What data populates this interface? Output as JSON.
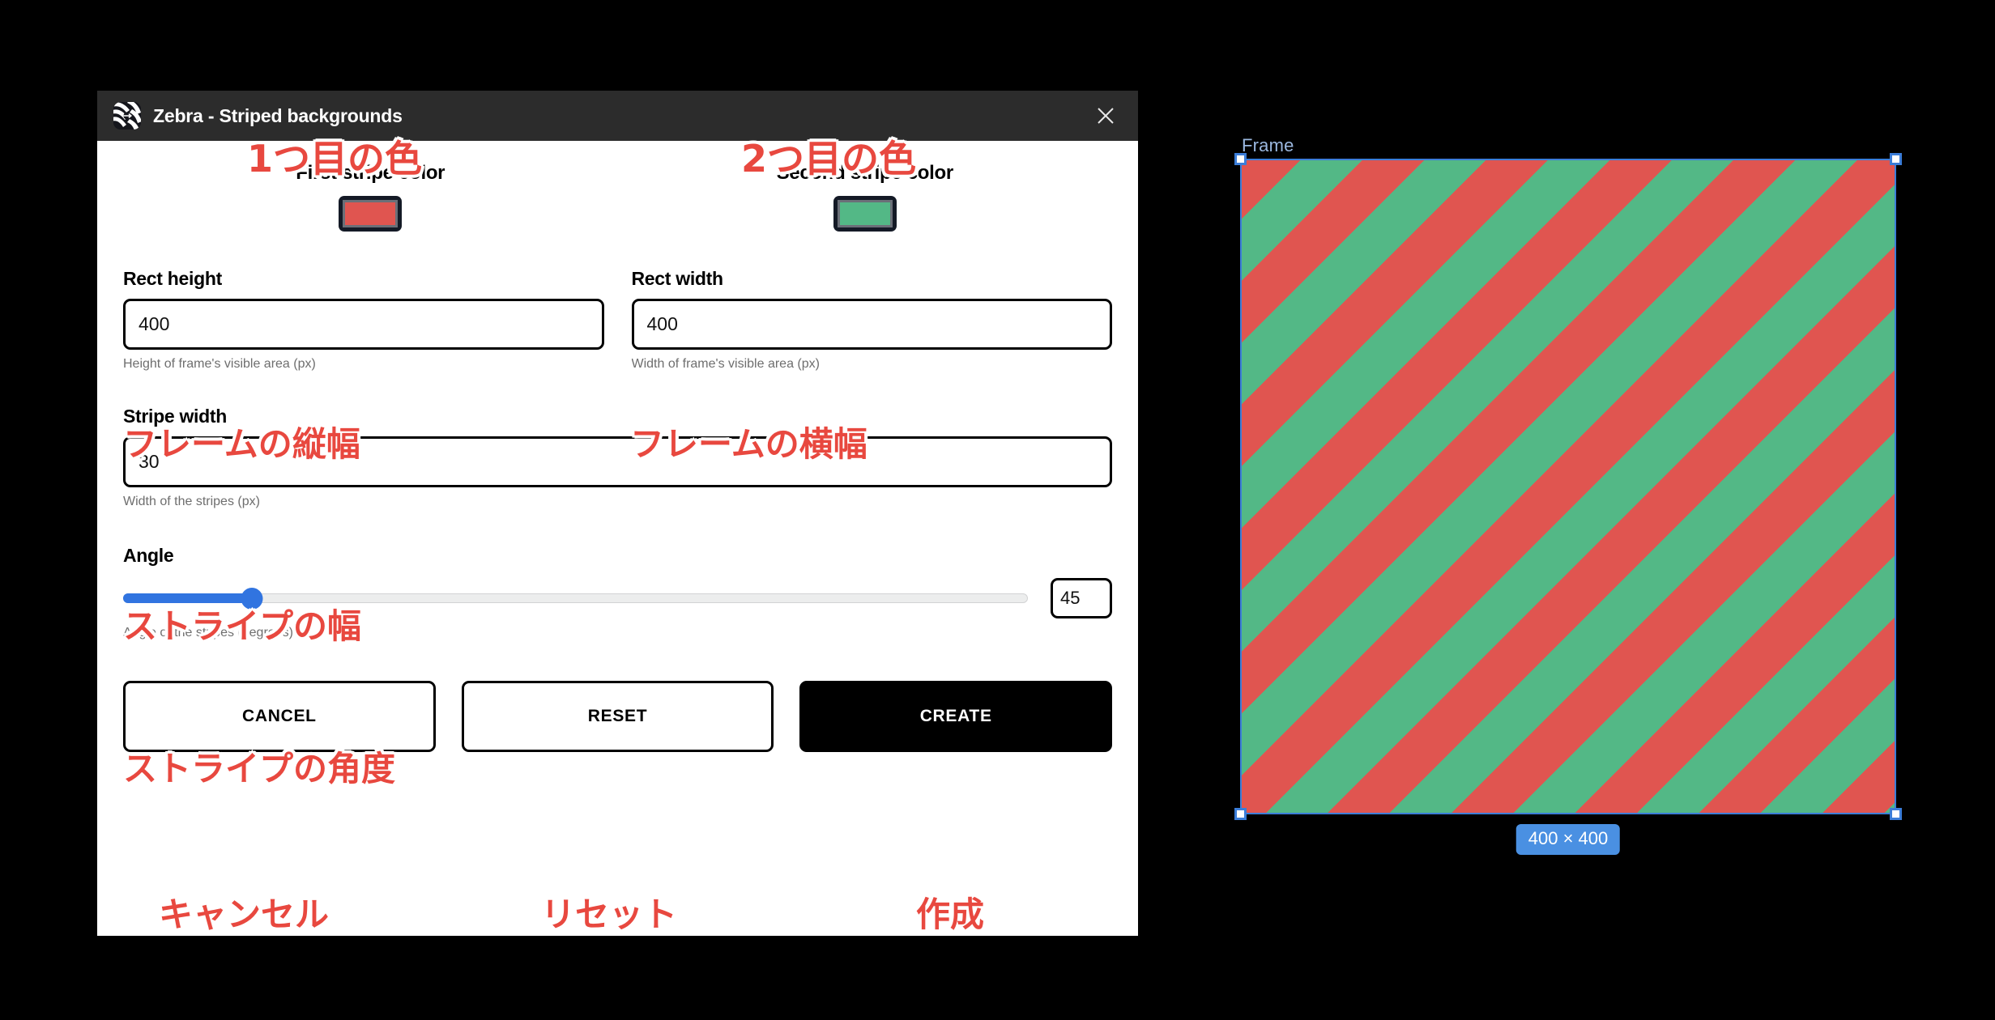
{
  "dialog": {
    "title": "Zebra - Striped backgrounds",
    "logo_icon": "zebra-stripes-icon",
    "close_icon": "close-icon",
    "colors": {
      "first": {
        "label": "First stripe color",
        "value": "#e05550",
        "annotation": "1つ目の色"
      },
      "second": {
        "label": "Second stripe color",
        "value": "#53b886",
        "annotation": "2つ目の色"
      }
    },
    "fields": {
      "rect_height": {
        "label": "Rect height",
        "value": "400",
        "hint": "Height of frame's visible area (px)",
        "annotation": "フレームの縦幅"
      },
      "rect_width": {
        "label": "Rect width",
        "value": "400",
        "hint": "Width of frame's visible area (px)",
        "annotation": "フレームの横幅"
      },
      "stripe_width": {
        "label": "Stripe width",
        "value": "30",
        "hint": "Width of the stripes (px)",
        "annotation": "ストライプの幅"
      },
      "angle": {
        "label": "Angle",
        "value": "45",
        "hint": "Angle of the stripes (degrees)",
        "annotation": "ストライプの角度",
        "min": "0",
        "max": "360",
        "slider_percent": 14.2,
        "accent": "#3174e0"
      }
    },
    "buttons": {
      "cancel": {
        "label": "CANCEL",
        "annotation": "キャンセル"
      },
      "reset": {
        "label": "RESET",
        "annotation": "リセット"
      },
      "create": {
        "label": "CREATE",
        "annotation": "作成"
      }
    }
  },
  "canvas": {
    "frame_name": "Frame",
    "size_badge": "400 × 400",
    "selection_color": "#3b7dd8",
    "badge_color": "#4a90e2",
    "stripe_angle_deg": 45,
    "stripe_colors": [
      "#e05550",
      "#53b886"
    ]
  }
}
